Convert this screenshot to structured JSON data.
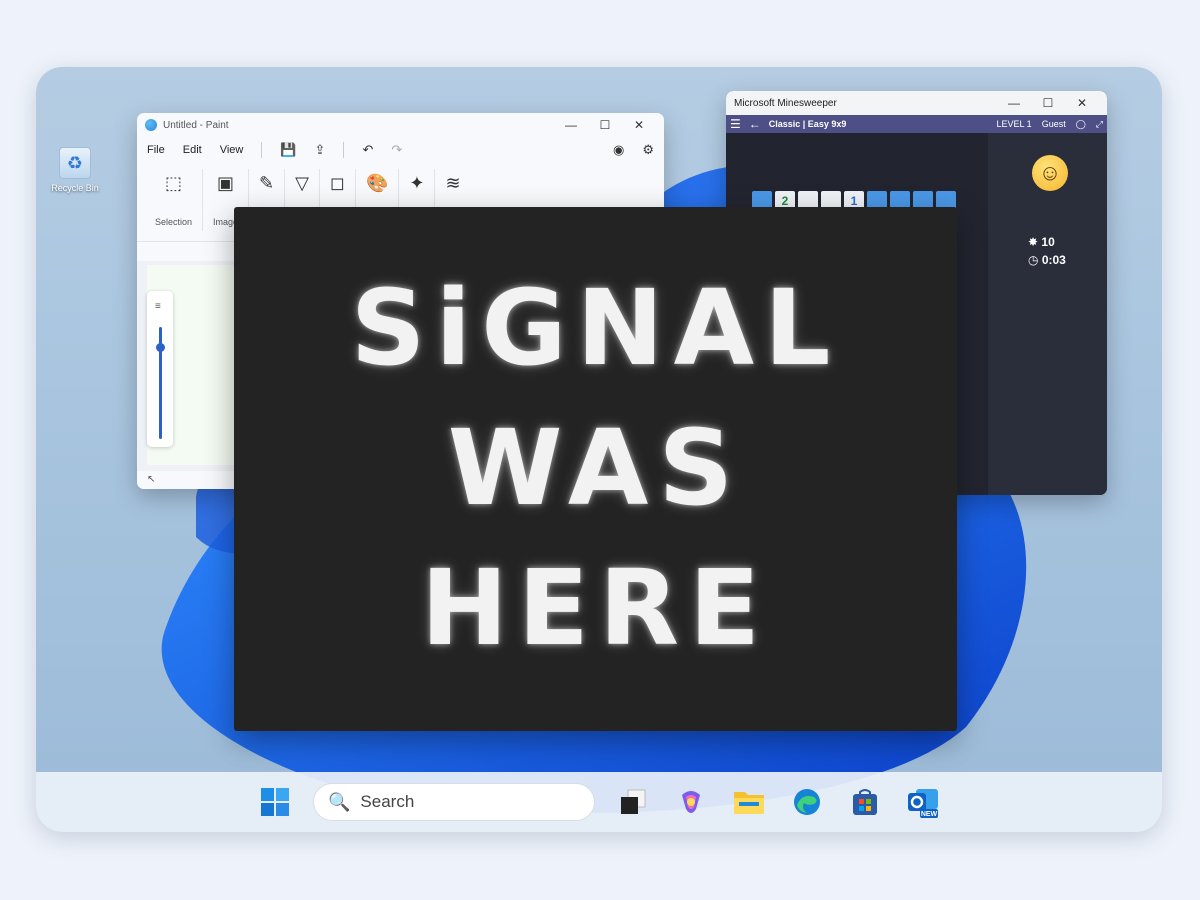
{
  "desktop": {
    "recycle_bin_label": "Recycle Bin"
  },
  "paint": {
    "title": "Untitled - Paint",
    "menu": [
      "File",
      "Edit",
      "View"
    ],
    "ribbon_groups": [
      "Selection",
      "Image"
    ]
  },
  "minesweeper": {
    "title": "Microsoft Minesweeper",
    "mode_label": "Classic | Easy 9x9",
    "menu_label": "Menu",
    "back_label": "Back",
    "level_label": "LEVEL 1",
    "user_label": "Guest",
    "mines_remaining": "10",
    "timer": "0:03",
    "visible_row": [
      "",
      "2",
      "",
      "",
      "1",
      "",
      "",
      "",
      ""
    ]
  },
  "overlay": {
    "line1": "SiGNAL",
    "line2": "WAS",
    "line3": "HERE"
  },
  "taskbar": {
    "search_placeholder": "Search",
    "apps": [
      "start-icon",
      "task-view-icon",
      "copilot-icon",
      "file-explorer-icon",
      "edge-icon",
      "store-icon",
      "outlook-icon"
    ],
    "outlook_badge": "NEW"
  }
}
